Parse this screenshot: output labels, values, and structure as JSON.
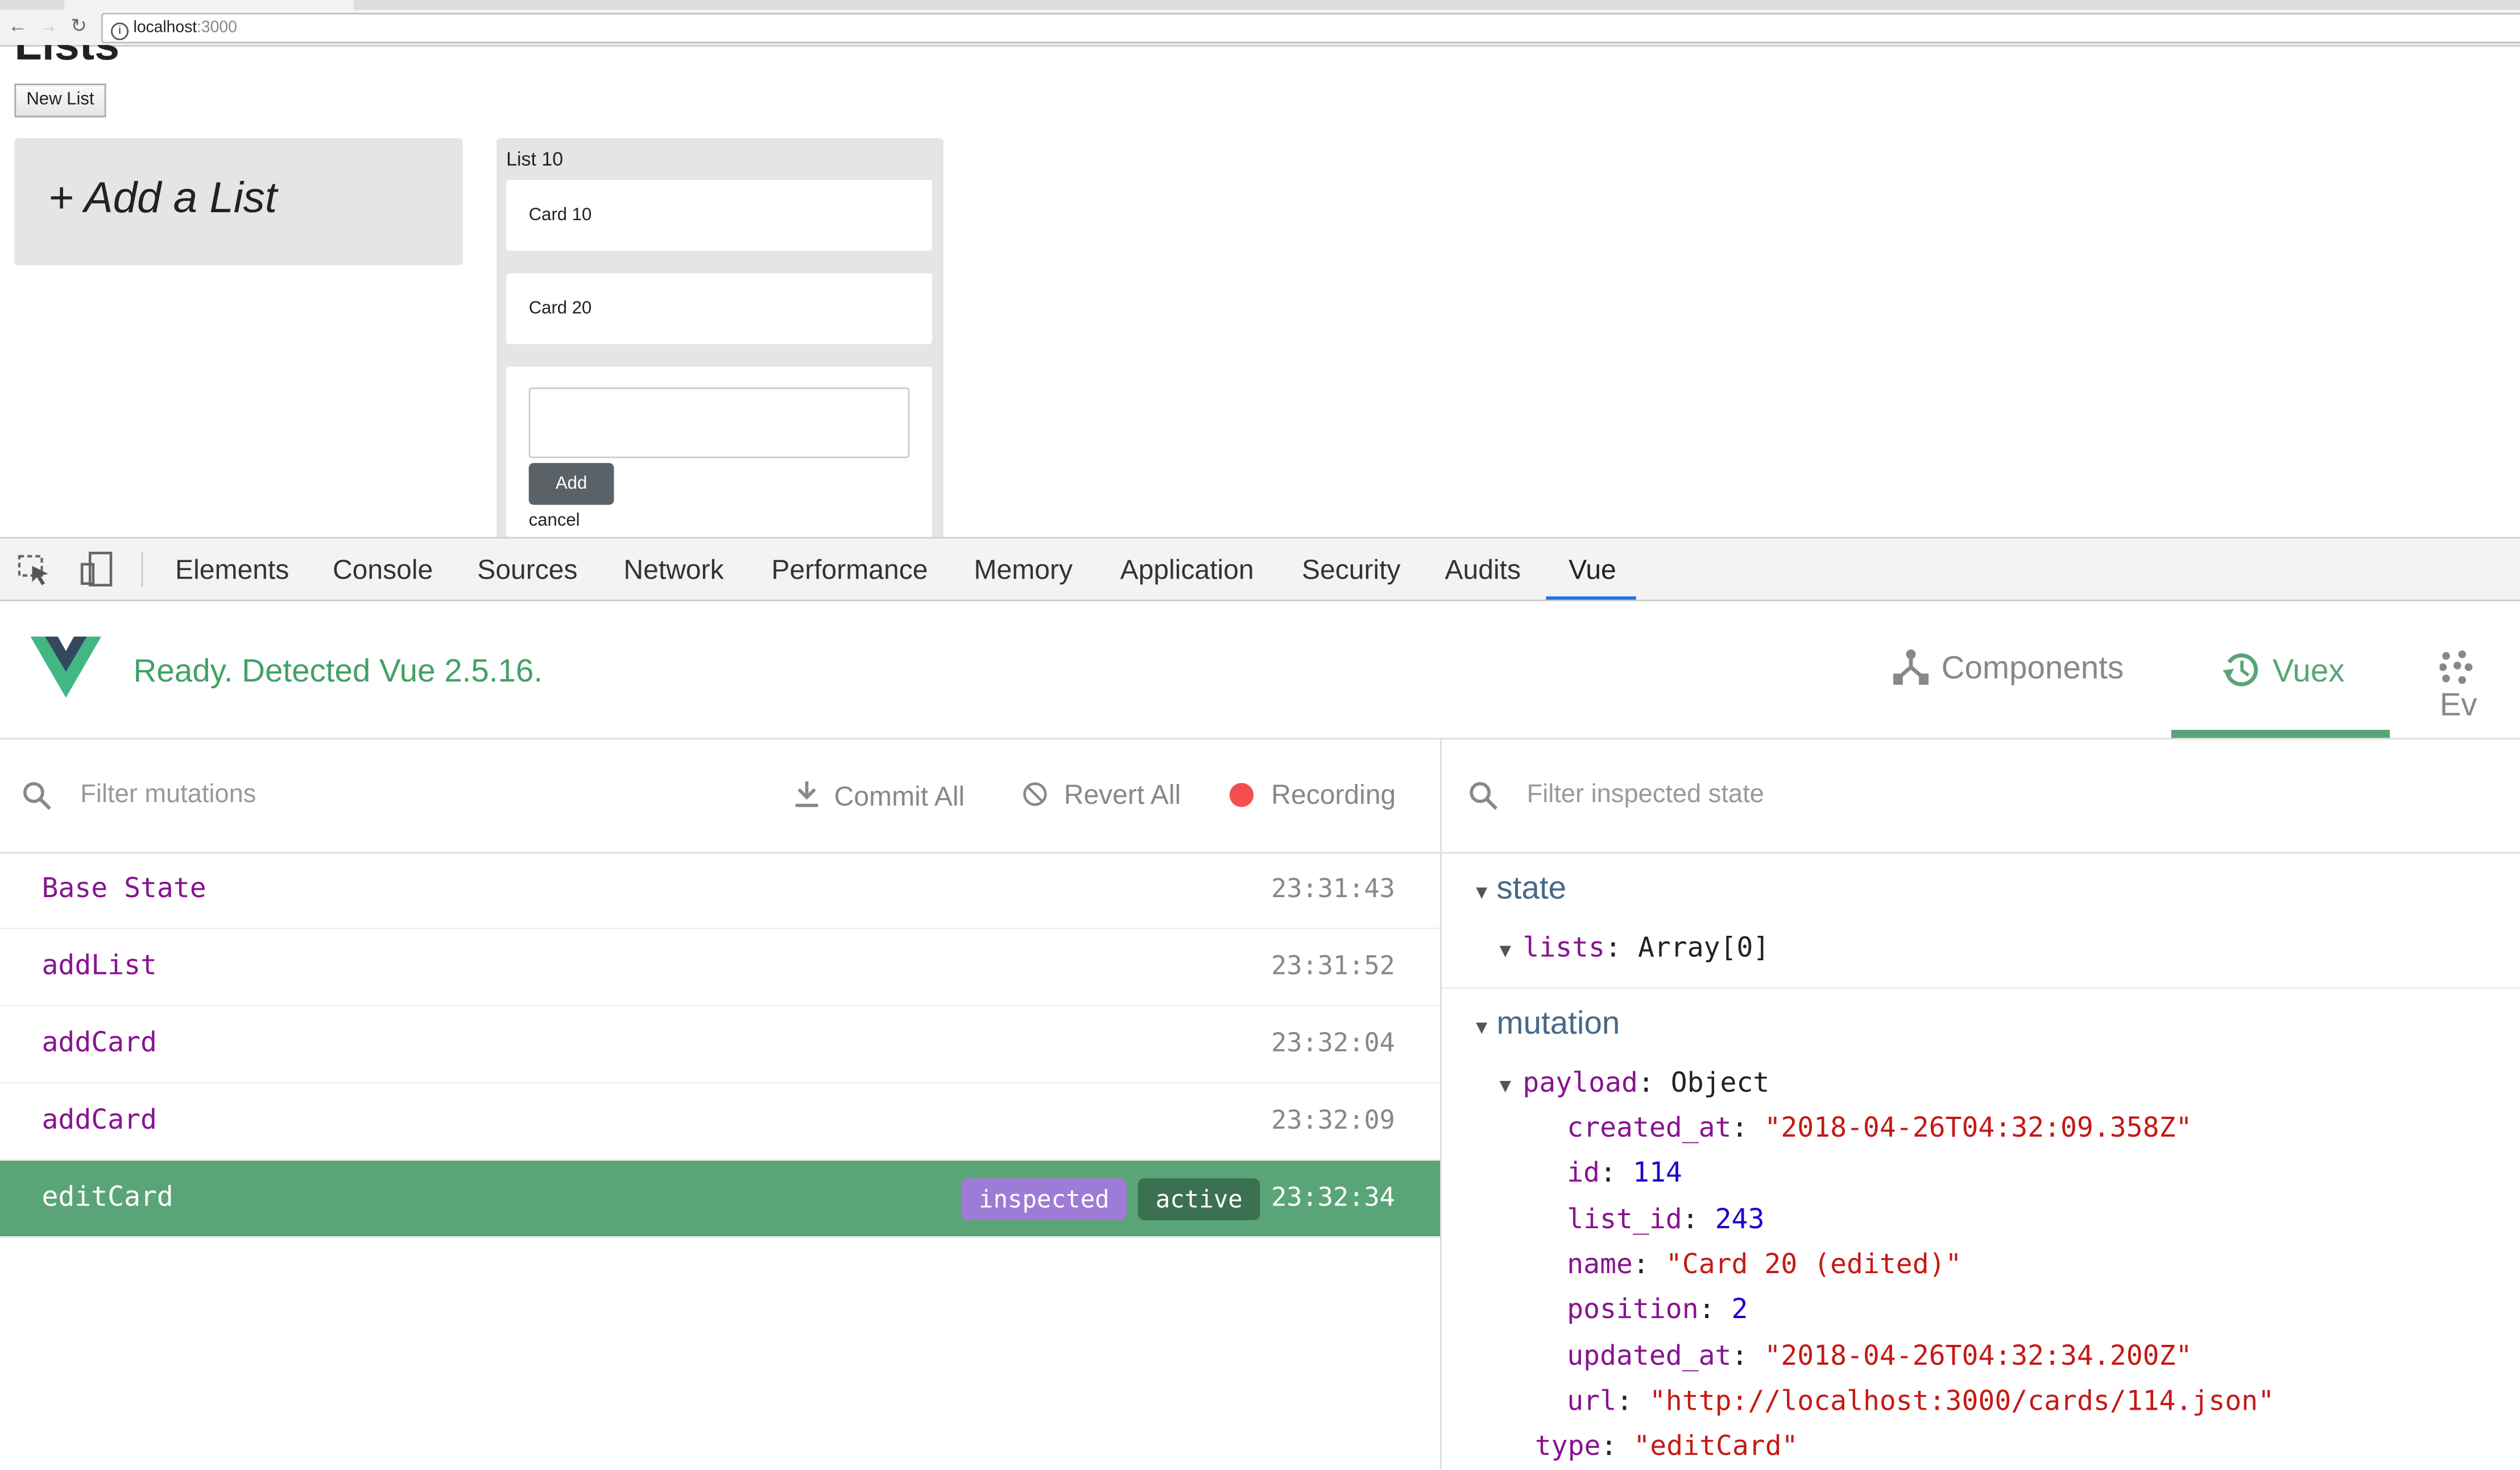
{
  "browser": {
    "url_host": "localhost",
    "url_port": ":3000"
  },
  "page": {
    "heading": "Lists",
    "new_list_button": "New List",
    "add_list": "+ Add a List",
    "list": {
      "title": "List 10",
      "cards": [
        "Card 10",
        "Card 20"
      ],
      "add_button": "Add",
      "cancel": "cancel"
    }
  },
  "devtools": {
    "tabs": [
      "Elements",
      "Console",
      "Sources",
      "Network",
      "Performance",
      "Memory",
      "Application",
      "Security",
      "Audits",
      "Vue"
    ],
    "active_tab": "Vue"
  },
  "vue": {
    "status": "Ready. Detected Vue 2.5.16.",
    "tabs": [
      "Components",
      "Vuex",
      "Ev"
    ],
    "active_tab": "Vuex",
    "accent": "#5aa577",
    "mutations": {
      "filter_placeholder": "Filter mutations",
      "commit_all": "Commit All",
      "revert_all": "Revert All",
      "recording": "Recording",
      "rows": [
        {
          "name": "Base State",
          "time": "23:31:43"
        },
        {
          "name": "addList",
          "time": "23:31:52"
        },
        {
          "name": "addCard",
          "time": "23:32:04"
        },
        {
          "name": "addCard",
          "time": "23:32:09"
        },
        {
          "name": "editCard",
          "time": "23:32:34",
          "inspected": "inspected",
          "active": "active"
        }
      ]
    },
    "state": {
      "filter_placeholder": "Filter inspected state",
      "state_label": "state",
      "lists_key": "lists",
      "lists_val": "Array[0]",
      "mutation_label": "mutation",
      "payload_key": "payload",
      "payload_val": "Object",
      "fields": [
        {
          "k": "created_at",
          "v": "\"2018-04-26T04:32:09.358Z\"",
          "t": "s"
        },
        {
          "k": "id",
          "v": "114",
          "t": "num"
        },
        {
          "k": "list_id",
          "v": "243",
          "t": "num"
        },
        {
          "k": "name",
          "v": "\"Card 20 (edited)\"",
          "t": "s"
        },
        {
          "k": "position",
          "v": "2",
          "t": "num"
        },
        {
          "k": "updated_at",
          "v": "\"2018-04-26T04:32:34.200Z\"",
          "t": "s"
        },
        {
          "k": "url",
          "v": "\"http://localhost:3000/cards/114.json\"",
          "t": "s"
        }
      ],
      "type_key": "type",
      "type_val": "\"editCard\""
    }
  }
}
